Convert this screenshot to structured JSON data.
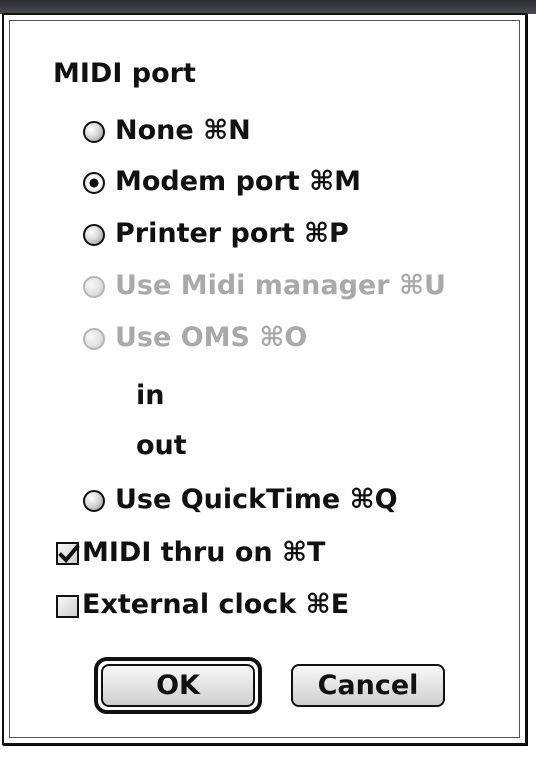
{
  "dialog": {
    "section_title": "MIDI port",
    "options": [
      {
        "label": "None ⌘N",
        "state": "unselected",
        "enabled": true
      },
      {
        "label": "Modem port ⌘M",
        "state": "selected",
        "enabled": true
      },
      {
        "label": "Printer port ⌘P",
        "state": "unselected",
        "enabled": true
      },
      {
        "label": "Use Midi manager ⌘U",
        "state": "unselected",
        "enabled": false
      },
      {
        "label": "Use OMS ⌘O",
        "state": "unselected",
        "enabled": false
      }
    ],
    "oms_in_label": "in",
    "oms_out_label": "out",
    "quicktime_option": {
      "label": "Use QuickTime ⌘Q",
      "state": "unselected",
      "enabled": true
    },
    "midi_thru": {
      "label": "MIDI thru on ⌘T",
      "checked": true
    },
    "external_clock": {
      "label": "External clock ⌘E",
      "checked": false
    },
    "ok_label": "OK",
    "cancel_label": "Cancel"
  },
  "colors": {
    "text": "#111111",
    "disabled_text": "#a9a9a9",
    "background": "#ffffff",
    "top_strip": "#3a3a42"
  },
  "icons": {
    "radio": "radio-button-icon",
    "checkbox": "checkbox-icon",
    "check": "checkmark-icon"
  }
}
